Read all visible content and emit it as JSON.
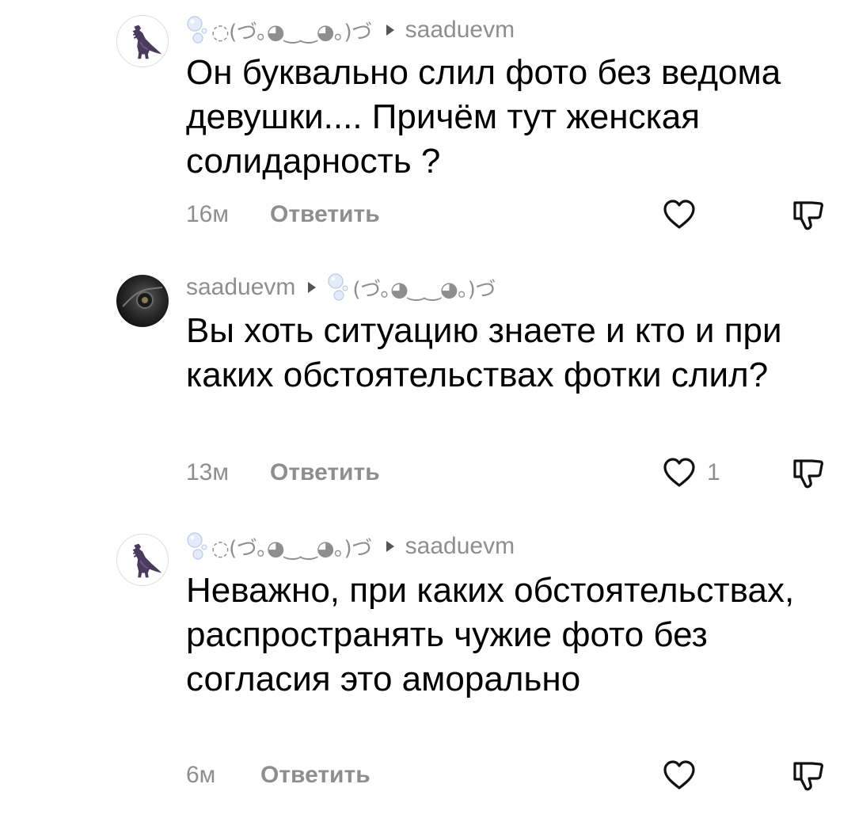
{
  "comments": [
    {
      "author": "◌(づ｡◕‿‿◕｡)づ",
      "author_icon": "bubble-icon",
      "reply_to": "saaduevm",
      "text": "Он буквально слил фото без ведома девушки.... Причём тут женская солидарность ?",
      "time": "16м",
      "reply_label": "Ответить",
      "likes": "",
      "avatar": "dinosaur"
    },
    {
      "author": "saaduevm",
      "reply_to": "(づ｡◕‿‿◕｡)づ",
      "reply_to_icon": "bubble-icon",
      "text": "Вы хоть ситуацию знаете и кто и при каких обстоятельствах фотки слил?",
      "time": "13м",
      "reply_label": "Ответить",
      "likes": "1",
      "avatar": "dark-photo"
    },
    {
      "author": "◌(づ｡◕‿‿◕｡)づ",
      "author_icon": "bubble-icon",
      "reply_to": "saaduevm",
      "text": "Неважно, при каких обстоятельствах, распространять чужие фото без согласия это аморально",
      "time": "6м",
      "reply_label": "Ответить",
      "likes": "",
      "avatar": "dinosaur"
    }
  ],
  "icons": {
    "like": "heart-outline-icon",
    "dislike": "thumbs-down-icon",
    "reply_arrow": "caret-right-icon"
  }
}
